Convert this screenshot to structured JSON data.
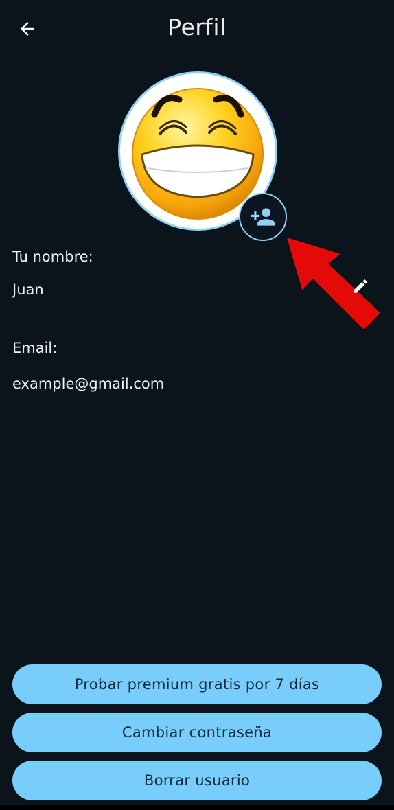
{
  "header": {
    "title": "Perfil",
    "back_icon": "arrow-left-icon"
  },
  "avatar": {
    "image": "laughing-emoji",
    "add_icon": "person-add-icon"
  },
  "profile": {
    "name_label": "Tu nombre:",
    "name_value": "Juan",
    "edit_icon": "pencil-icon",
    "email_label": "Email:",
    "email_value": "example@gmail.com"
  },
  "actions": {
    "premium_label": "Probar premium gratis por 7 días",
    "change_password_label": "Cambiar contraseña",
    "delete_user_label": "Borrar usuario"
  },
  "annotation": {
    "arrow_icon": "red-arrow-icon"
  },
  "colors": {
    "background": "#0b131b",
    "accent": "#79cdfa",
    "annotation": "#e40a0a"
  }
}
